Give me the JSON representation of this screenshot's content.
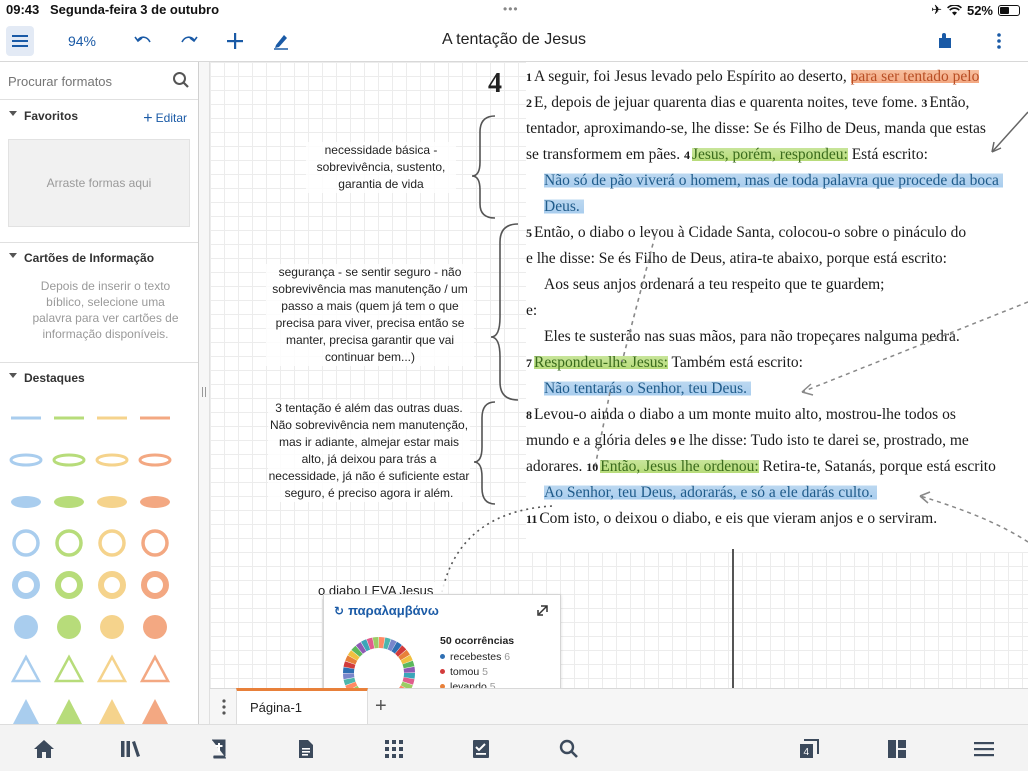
{
  "status": {
    "time": "09:43",
    "date": "Segunda-feira 3 de outubro",
    "battery": "52%",
    "battery_level": 0.52
  },
  "toolbar": {
    "zoom": "94%",
    "title": "A tentação de Jesus",
    "icons": [
      "menu-icon",
      "undo-icon",
      "redo-icon",
      "plus-icon",
      "pen-icon",
      "plugin-icon",
      "more-icon"
    ]
  },
  "leftpanel": {
    "search_placeholder": "Procurar formatos",
    "favorites": {
      "label": "Favoritos",
      "edit": "Editar",
      "dropzone": "Arraste formas aqui"
    },
    "info_cards": {
      "label": "Cartões de Informação",
      "text": "Depois de inserir o texto bíblico, selecione uma palavra para ver cartões de informação disponíveis."
    },
    "highlights": {
      "label": "Destaques"
    },
    "shape_colors": [
      "#a9cdee",
      "#b7dc7a",
      "#f5d38c",
      "#f3a882"
    ]
  },
  "bible": {
    "chapter": "4",
    "lines": [
      [
        {
          "v": "1"
        },
        {
          "t": "A seguir, foi Jesus levado pelo Espírito ao deserto, "
        },
        {
          "t": "para ser tentado pelo",
          "h": "o"
        }
      ],
      [
        {
          "v": "2"
        },
        {
          "t": "E, depois de jejuar quarenta dias e quarenta noites, teve fome. "
        },
        {
          "v": "3"
        },
        {
          "t": "Então,"
        }
      ],
      [
        {
          "t": "tentador, aproximando-se, lhe disse: Se és Filho de Deus, manda que estas"
        }
      ],
      [
        {
          "t": "se transformem em pães. "
        },
        {
          "v": "4"
        },
        {
          "t": "Jesus, porém, respondeu:",
          "h": "g"
        },
        {
          "t": " Está escrito:"
        }
      ],
      [
        {
          "t": "Não só de pão viverá o homem, mas de toda palavra que procede da boca",
          "h": "b",
          "i": true
        }
      ],
      [
        {
          "t": "Deus.",
          "h": "b",
          "i": true
        }
      ],
      [
        {
          "v": "5"
        },
        {
          "t": "Então,  o diabo o levou à Cidade Santa, colocou-o sobre o pináculo do"
        }
      ],
      [
        {
          "t": "e lhe disse: Se és Filho de Deus, atira-te abaixo, porque está escrito:"
        }
      ],
      [
        {
          "t": "Aos seus anjos ordenará a teu respeito que te guardem;",
          "i": true
        }
      ],
      [
        {
          "t": "e:"
        }
      ],
      [
        {
          "t": "Eles te susterão nas suas mãos, para não tropeçares nalguma pedra.",
          "i": true
        }
      ],
      [
        {
          "v": "7"
        },
        {
          "t": "Respondeu-lhe Jesus:",
          "h": "g"
        },
        {
          "t": " Também está escrito:"
        }
      ],
      [
        {
          "t": "Não tentarás o Senhor, teu Deus.",
          "h": "b",
          "i": true
        }
      ],
      [
        {
          "v": "8"
        },
        {
          "t": "Levou-o ainda o diabo a um monte muito alto, mostrou-lhe todos os"
        }
      ],
      [
        {
          "t": "mundo e a glória deles "
        },
        {
          "v": "9"
        },
        {
          "t": "e lhe disse: Tudo isto te darei se, prostrado, me"
        }
      ],
      [
        {
          "t": "adorares. "
        },
        {
          "v": "10"
        },
        {
          "t": "Então, Jesus lhe ordenou:",
          "h": "g"
        },
        {
          "t": " Retira-te, Satanás, porque está escrito"
        }
      ],
      [
        {
          "t": "Ao Senhor, teu Deus, adorarás, e só a ele darás culto.",
          "h": "b",
          "i": true
        }
      ],
      [
        {
          "v": "11"
        },
        {
          "t": "Com isto, o deixou o diabo, e eis que vieram anjos e o serviram."
        }
      ]
    ]
  },
  "notes": {
    "n1": "necessidade básica - sobrevivência, sustento, garantia de vida",
    "n2": "segurança - se sentir seguro - não sobrevivência mas manutenção / um passo a mais (quem já tem o que precisa para viver, precisa então se manter, precisa garantir que vai continuar bem...)",
    "n3": "3 tentação é além das outras duas. Não sobrevivência nem manutenção, mas ir adiante, almejar estar mais alto, já deixou para trás a necessidade, já não é suficiente estar seguro, é preciso agora ir além.",
    "n4": "o diabo LEVA Jesus"
  },
  "wordcard": {
    "word": "παραλαμβάνω",
    "occurrences": "50 ocorrências",
    "rows": [
      {
        "label": "recebestes",
        "count": "6",
        "color": "#2f6fb3"
      },
      {
        "label": "tomou",
        "count": "5",
        "color": "#d23b3b"
      },
      {
        "label": "levando",
        "count": "5",
        "color": "#e8803a"
      }
    ],
    "donut_colors": [
      "#2f6fb3",
      "#d23b3b",
      "#e8803a",
      "#f0c040",
      "#5cb85c",
      "#8e5bb5",
      "#3aa6b9",
      "#e05d8c",
      "#9ccc65",
      "#ff8a65",
      "#4db6ac",
      "#7986cb"
    ]
  },
  "pagetabs": {
    "tab": "Página-1"
  },
  "bottomnav": [
    "home-icon",
    "library-icon",
    "bible-icon",
    "document-icon",
    "apps-icon",
    "checklist-icon",
    "search-icon",
    "layers-icon",
    "layout-icon",
    "menu-icon"
  ]
}
